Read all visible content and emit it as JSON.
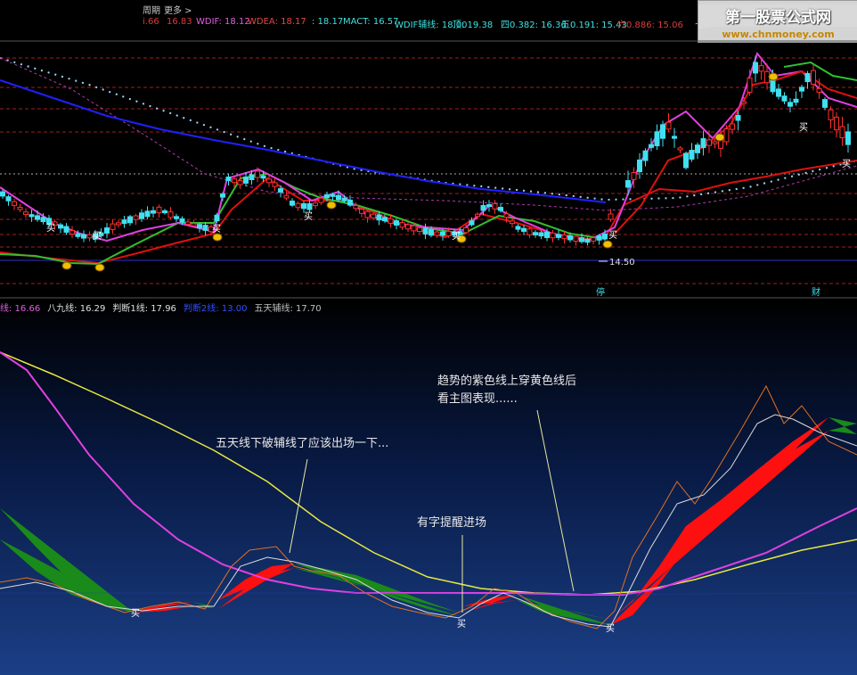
{
  "header": {
    "period": "周期",
    "more": "更多 >",
    "items": [
      {
        "text": "i.66",
        "color": "#dd3b3b"
      },
      {
        "text": "16.83",
        "color": "#dd3b3b"
      },
      {
        "text": "WDIF: 18.12",
        "color": "#e060e0"
      },
      {
        "text": "WDEA: 18.17",
        "color": "#e84646"
      },
      {
        "text": ": 18.17",
        "color": "#40e0e0"
      },
      {
        "text": "MACT: 16.57",
        "color": "#40e0e0"
      },
      {
        "text": "WDIF辅线: 18.00",
        "color": "#40e0e0"
      },
      {
        "text": "顶: 19.38",
        "color": "#40e0e0"
      },
      {
        "text": "四0.382: 16.36",
        "color": "#40e0e0"
      },
      {
        "text": "五0.191: 15.43",
        "color": "#40e0e0"
      },
      {
        "text": "六0.886: 15.06",
        "color": "#dd3b3b"
      },
      {
        "text": "七0",
        "color": "#40e0e0"
      }
    ]
  },
  "logo": {
    "line1": "第一股票公式网",
    "line2": "www.chnmoney.com"
  },
  "main_chart": {
    "price_label": "14.50",
    "buy_label": "买",
    "bottom_markers": [
      "停",
      "财"
    ]
  },
  "sub_header": [
    {
      "text": "线: 16.66",
      "color": "#e060e0"
    },
    {
      "text": "八九线: 16.29",
      "color": "#e0e0e0"
    },
    {
      "text": "判断1线: 17.96",
      "color": "#e0e0e0"
    },
    {
      "text": "判断2线: 13.00",
      "color": "#3050ff"
    },
    {
      "text": "五天辅线: 17.70",
      "color": "#c0c0c0"
    }
  ],
  "annotations": {
    "note1": "趋势的紫色线上穿黄色线后",
    "note2": "看主图表现......",
    "note3": "五天线下破辅线了应该出场一下...",
    "note4": "有字提醒进场",
    "buy": "买"
  },
  "colors": {
    "up": "#ff3030",
    "down": "#40e0f0",
    "ma_blue": "#2020ff",
    "ma_red": "#e01010",
    "ma_green": "#30c030",
    "ma_magenta": "#e040e0",
    "yellow": "#e8e840",
    "orange": "#e07020",
    "ribbon_red": "#ff1010",
    "ribbon_green": "#1a8a1a"
  },
  "chart_data": {
    "type": "line",
    "panels": [
      {
        "name": "main",
        "kind": "candlestick",
        "reference_levels": [
          14.5
        ],
        "markers": [
          "买",
          "停",
          "财"
        ]
      },
      {
        "name": "indicator",
        "series": [
          "线",
          "八九线",
          "判断1线",
          "判断2线",
          "五天辅线"
        ],
        "latest_values": [
          16.66,
          16.29,
          17.96,
          13.0,
          17.7
        ]
      }
    ]
  }
}
